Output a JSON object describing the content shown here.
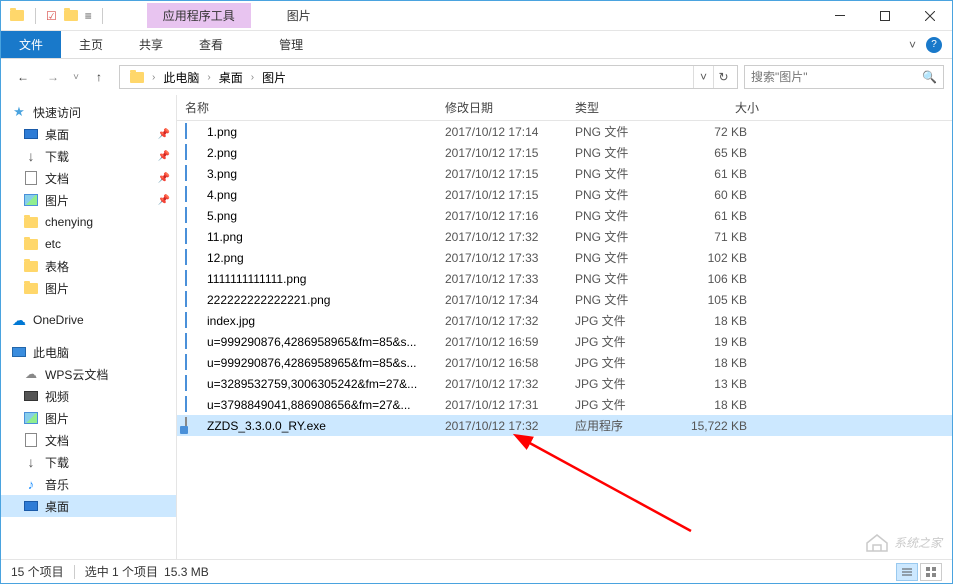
{
  "title_context": {
    "tools_label": "应用程序工具",
    "location_label": "图片",
    "manage_label": "管理"
  },
  "ribbon": {
    "file": "文件",
    "home": "主页",
    "share": "共享",
    "view": "查看"
  },
  "breadcrumb": {
    "this_pc": "此电脑",
    "desktop": "桌面",
    "pictures": "图片"
  },
  "search": {
    "placeholder": "搜索\"图片\""
  },
  "sidebar": {
    "quick_access": "快速访问",
    "qa_items": [
      {
        "label": "桌面",
        "pinned": true,
        "icon": "desktop"
      },
      {
        "label": "下载",
        "pinned": true,
        "icon": "download"
      },
      {
        "label": "文档",
        "pinned": true,
        "icon": "doc"
      },
      {
        "label": "图片",
        "pinned": true,
        "icon": "img"
      },
      {
        "label": "chenying",
        "pinned": false,
        "icon": "folder"
      },
      {
        "label": "etc",
        "pinned": false,
        "icon": "folder"
      },
      {
        "label": "表格",
        "pinned": false,
        "icon": "folder"
      },
      {
        "label": "图片",
        "pinned": false,
        "icon": "folder"
      }
    ],
    "onedrive": "OneDrive",
    "this_pc": "此电脑",
    "pc_items": [
      {
        "label": "WPS云文档",
        "icon": "cloud"
      },
      {
        "label": "视频",
        "icon": "video"
      },
      {
        "label": "图片",
        "icon": "img"
      },
      {
        "label": "文档",
        "icon": "doc"
      },
      {
        "label": "下载",
        "icon": "download"
      },
      {
        "label": "音乐",
        "icon": "music"
      },
      {
        "label": "桌面",
        "icon": "desktop",
        "selected": true
      }
    ]
  },
  "columns": {
    "name": "名称",
    "date": "修改日期",
    "type": "类型",
    "size": "大小"
  },
  "files": [
    {
      "name": "1.png",
      "date": "2017/10/12 17:14",
      "type": "PNG 文件",
      "size": "72 KB",
      "icon": "img"
    },
    {
      "name": "2.png",
      "date": "2017/10/12 17:15",
      "type": "PNG 文件",
      "size": "65 KB",
      "icon": "img"
    },
    {
      "name": "3.png",
      "date": "2017/10/12 17:15",
      "type": "PNG 文件",
      "size": "61 KB",
      "icon": "img"
    },
    {
      "name": "4.png",
      "date": "2017/10/12 17:15",
      "type": "PNG 文件",
      "size": "60 KB",
      "icon": "img"
    },
    {
      "name": "5.png",
      "date": "2017/10/12 17:16",
      "type": "PNG 文件",
      "size": "61 KB",
      "icon": "img"
    },
    {
      "name": "11.png",
      "date": "2017/10/12 17:32",
      "type": "PNG 文件",
      "size": "71 KB",
      "icon": "img"
    },
    {
      "name": "12.png",
      "date": "2017/10/12 17:33",
      "type": "PNG 文件",
      "size": "102 KB",
      "icon": "img"
    },
    {
      "name": "1111111111111.png",
      "date": "2017/10/12 17:33",
      "type": "PNG 文件",
      "size": "106 KB",
      "icon": "img"
    },
    {
      "name": "222222222222221.png",
      "date": "2017/10/12 17:34",
      "type": "PNG 文件",
      "size": "105 KB",
      "icon": "img"
    },
    {
      "name": "index.jpg",
      "date": "2017/10/12 17:32",
      "type": "JPG 文件",
      "size": "18 KB",
      "icon": "img"
    },
    {
      "name": "u=999290876,4286958965&fm=85&s...",
      "date": "2017/10/12 16:59",
      "type": "JPG 文件",
      "size": "19 KB",
      "icon": "img"
    },
    {
      "name": "u=999290876,4286958965&fm=85&s...",
      "date": "2017/10/12 16:58",
      "type": "JPG 文件",
      "size": "18 KB",
      "icon": "img"
    },
    {
      "name": "u=3289532759,3006305242&fm=27&...",
      "date": "2017/10/12 17:32",
      "type": "JPG 文件",
      "size": "13 KB",
      "icon": "img"
    },
    {
      "name": "u=3798849041,886908656&fm=27&...",
      "date": "2017/10/12 17:31",
      "type": "JPG 文件",
      "size": "18 KB",
      "icon": "img"
    },
    {
      "name": "ZZDS_3.3.0.0_RY.exe",
      "date": "2017/10/12 17:32",
      "type": "应用程序",
      "size": "15,722 KB",
      "icon": "exe",
      "selected": true
    }
  ],
  "status": {
    "count": "15 个项目",
    "selected": "选中 1 个项目",
    "size": "15.3 MB"
  },
  "watermark": "系统之家"
}
